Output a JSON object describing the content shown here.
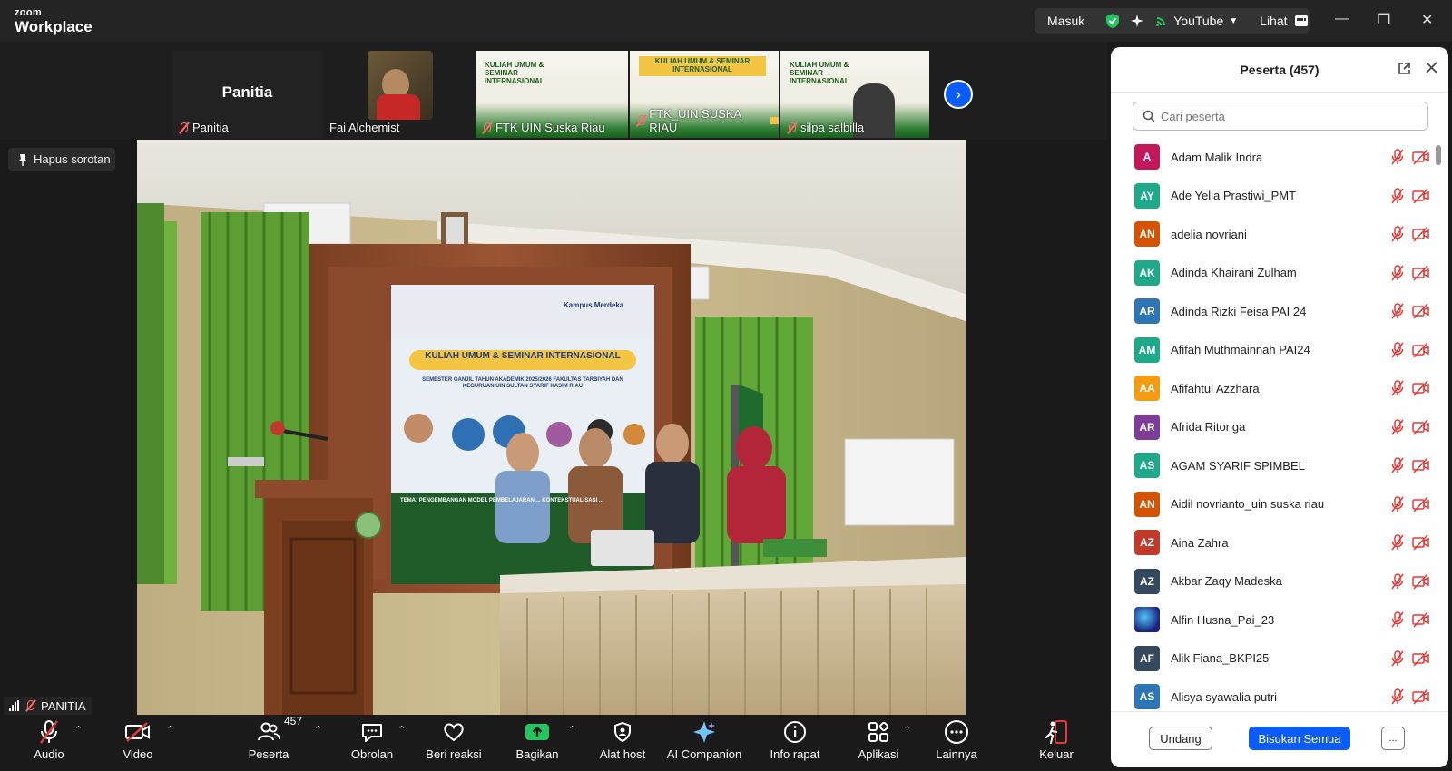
{
  "app": {
    "logo_small": "zoom",
    "logo_big": "Workplace"
  },
  "titlebar": {
    "masuk": "Masuk",
    "youtube": "YouTube",
    "lihat": "Lihat"
  },
  "strip": {
    "tiles": [
      {
        "name": "Panitia",
        "center_label": "Panitia"
      },
      {
        "name": "Fai Alchemist"
      },
      {
        "name": "FTK UIN Suska Riau"
      },
      {
        "name": "FTK_UIN SUSKA RIAU"
      },
      {
        "name": "silpa salbilla"
      }
    ],
    "banner_text": "KULIAH UMUM & SEMINAR INTERNASIONAL"
  },
  "spotlight": {
    "label": "Hapus sorotan"
  },
  "video": {
    "banner_title": "KULIAH UMUM & SEMINAR INTERNASIONAL",
    "banner_sub": "SEMESTER GANJIL TAHUN AKADEMIK 2025/2026 FAKULTAS TARBIYAH DAN KEGURUAN UIN SULTAN SYARIF KASIM RIAU",
    "banner_theme": "TEMA: PENGEMBANGAN MODEL PEMBELAJARAN ... KONTEKSTUALISASI ...",
    "logo_text": "Kampus Merdeka"
  },
  "self_label": "PANITIA",
  "toolbar": {
    "audio": "Audio",
    "video": "Video",
    "participants": "Peserta",
    "participants_count": "457",
    "chat": "Obrolan",
    "reaction": "Beri reaksi",
    "share": "Bagikan",
    "host_tools": "Alat host",
    "ai": "AI Companion",
    "info": "Info rapat",
    "apps": "Aplikasi",
    "more": "Lainnya",
    "leave": "Keluar"
  },
  "panel": {
    "title": "Peserta (457)",
    "search_placeholder": "Cari peserta",
    "participants": [
      {
        "initials": "A",
        "name": "Adam Malik Indra",
        "color": "#c2185b"
      },
      {
        "initials": "AY",
        "name": "Ade Yelia Prastiwi_PMT",
        "color": "#1fa88a"
      },
      {
        "initials": "AN",
        "name": "adelia novriani",
        "color": "#d35400"
      },
      {
        "initials": "AK",
        "name": "Adinda Khairani Zulham",
        "color": "#1fa88a"
      },
      {
        "initials": "AR",
        "name": "Adinda Rizki Feisa PAI 24",
        "color": "#2e75b6"
      },
      {
        "initials": "AM",
        "name": "Afifah Muthmainnah PAI24",
        "color": "#1fa88a"
      },
      {
        "initials": "AA",
        "name": "Afifahtul Azzhara",
        "color": "#f39c12"
      },
      {
        "initials": "AR",
        "name": "Afrida Ritonga",
        "color": "#7d3c98"
      },
      {
        "initials": "AS",
        "name": "AGAM SYARIF SPIMBEL",
        "color": "#1fa88a"
      },
      {
        "initials": "AN",
        "name": "Aidil novrianto_uin suska riau",
        "color": "#d35400"
      },
      {
        "initials": "AZ",
        "name": "Aina Zahra",
        "color": "#c0392b"
      },
      {
        "initials": "AZ",
        "name": "Akbar Zaqy Madeska",
        "color": "#34495e"
      },
      {
        "initials": "",
        "name": "Alfin Husna_Pai_23",
        "color": "#1a237e"
      },
      {
        "initials": "AF",
        "name": "Alik Fiana_BKPI25",
        "color": "#34495e"
      },
      {
        "initials": "AS",
        "name": "Alisya syawalia putri",
        "color": "#2e75b6"
      }
    ],
    "invite": "Undang",
    "mute_all": "Bisukan Semua",
    "more": "..."
  },
  "colors": {
    "accent": "#0b5cff",
    "share_green": "#22c55e",
    "leave_red": "#e53935",
    "muted_red": "#e53935"
  }
}
